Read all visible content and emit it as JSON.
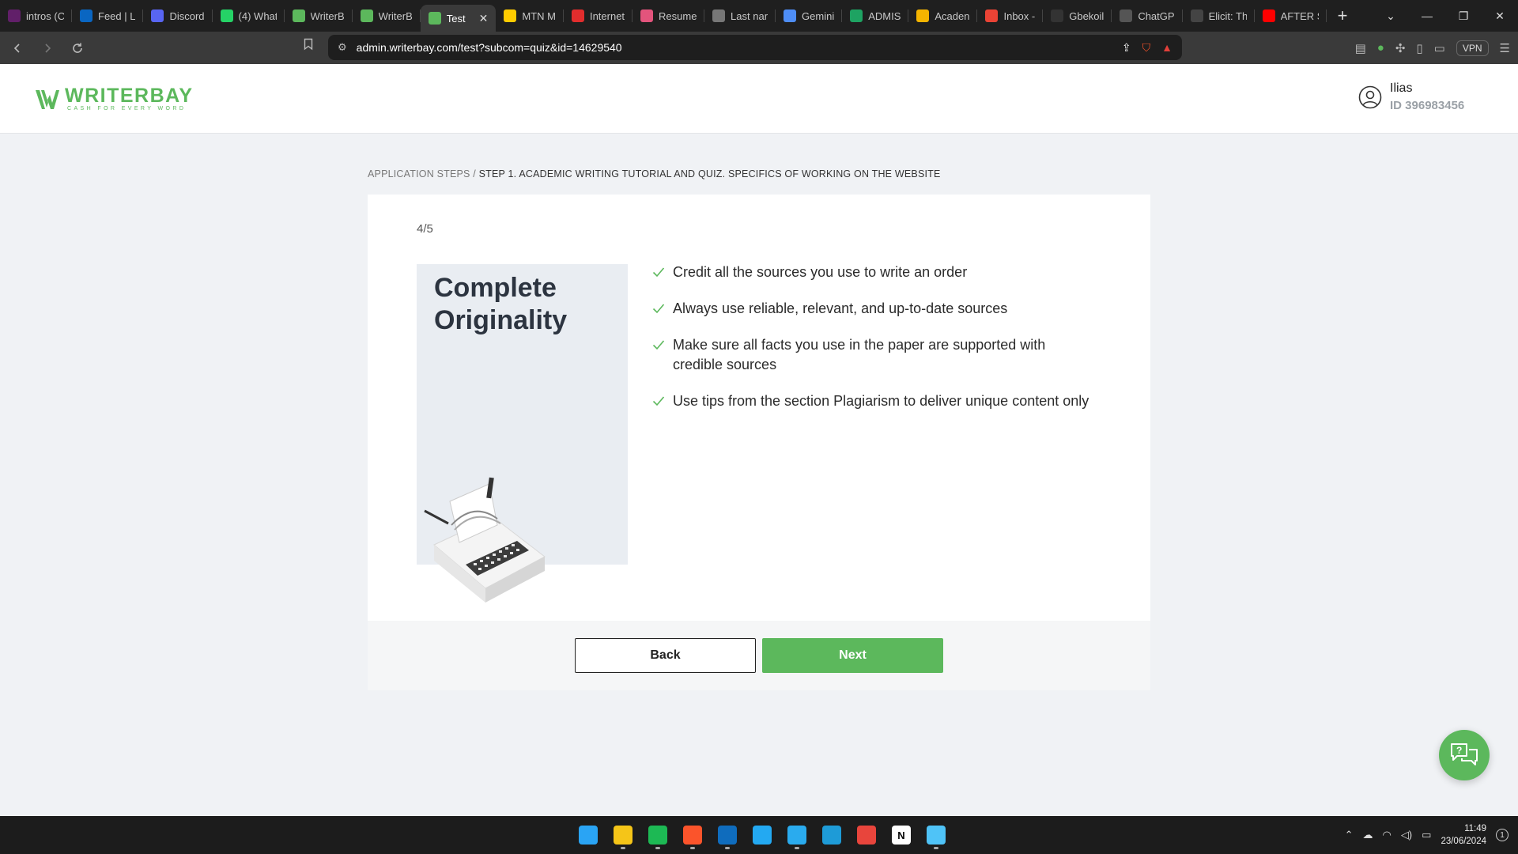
{
  "browser": {
    "tabs": [
      {
        "label": "intros (C",
        "icon": "slack-icon",
        "color": "#611f69"
      },
      {
        "label": "Feed | L",
        "icon": "linkedin-icon",
        "color": "#0a66c2"
      },
      {
        "label": "Discord",
        "icon": "discord-icon",
        "color": "#5865f2"
      },
      {
        "label": "(4) What",
        "icon": "whatsapp-icon",
        "color": "#25d366"
      },
      {
        "label": "WriterB",
        "icon": "writerbay-icon",
        "color": "#5cb85c"
      },
      {
        "label": "WriterB",
        "icon": "writerbay-icon",
        "color": "#5cb85c"
      },
      {
        "label": "Test",
        "icon": "writerbay-icon",
        "color": "#5cb85c",
        "active": true
      },
      {
        "label": "MTN M",
        "icon": "mtn-icon",
        "color": "#ffcc00"
      },
      {
        "label": "Internet",
        "icon": "internet-icon",
        "color": "#e22d2d"
      },
      {
        "label": "Resume",
        "icon": "resume-icon",
        "color": "#e3547c"
      },
      {
        "label": "Last nar",
        "icon": "gear-icon",
        "color": "#777777"
      },
      {
        "label": "Gemini",
        "icon": "gemini-icon",
        "color": "#4e8df5"
      },
      {
        "label": "ADMIS",
        "icon": "sheets-icon",
        "color": "#1ea362"
      },
      {
        "label": "Acaden",
        "icon": "drive-icon",
        "color": "#f4b400"
      },
      {
        "label": "Inbox -",
        "icon": "gmail-icon",
        "color": "#ea4335"
      },
      {
        "label": "Gbekoil",
        "icon": "github-icon",
        "color": "#333333"
      },
      {
        "label": "ChatGP",
        "icon": "chatgpt-icon",
        "color": "#555555"
      },
      {
        "label": "Elicit: Th",
        "icon": "elicit-icon",
        "color": "#444444"
      },
      {
        "label": "AFTER S",
        "icon": "youtube-icon",
        "color": "#ff0000"
      }
    ],
    "url": "admin.writerbay.com/test?subcom=quiz&id=14629540",
    "vpn_label": "VPN"
  },
  "site": {
    "logo_name": "WRITERBAY",
    "logo_tagline": "CASH FOR EVERY WORD",
    "user_name": "Ilias",
    "user_id": "ID 396983456"
  },
  "breadcrumb": {
    "root": "APPLICATION STEPS /",
    "current": "STEP 1. ACADEMIC WRITING TUTORIAL AND QUIZ. SPECIFICS OF WORKING ON THE WEBSITE"
  },
  "lesson": {
    "progress": "4/5",
    "title_line1": "Complete",
    "title_line2": "Originality",
    "tips": [
      "Credit all the sources you use to write an order",
      "Always use reliable, relevant, and up-to-date sources",
      "Make sure all facts you use in the paper are supported with credible sources",
      "Use tips from the section Plagiarism to deliver unique content only"
    ],
    "back_label": "Back",
    "next_label": "Next"
  },
  "taskbar": {
    "apps": [
      {
        "name": "windows-start-icon",
        "color": "#2aa4f4",
        "running": false
      },
      {
        "name": "file-explorer-icon",
        "color": "#f5c518",
        "running": true
      },
      {
        "name": "spotify-icon",
        "color": "#1db954",
        "running": true
      },
      {
        "name": "brave-icon",
        "color": "#fb542b",
        "running": true
      },
      {
        "name": "outlook-icon",
        "color": "#0f6cbd",
        "running": true
      },
      {
        "name": "vscode-icon",
        "color": "#23a9f2",
        "running": false
      },
      {
        "name": "telegram-icon",
        "color": "#2aabee",
        "running": true
      },
      {
        "name": "edge-icon",
        "color": "#1e9bd7",
        "running": false
      },
      {
        "name": "chrome-icon",
        "color": "#e8453c",
        "running": false
      },
      {
        "name": "notion-icon",
        "color": "#ffffff",
        "running": false
      },
      {
        "name": "notepad-icon",
        "color": "#4fc3f7",
        "running": true
      }
    ],
    "time": "11:49",
    "date": "23/06/2024",
    "notifications": "1"
  },
  "colors": {
    "brand_green": "#5cb85c",
    "page_bg": "#f0f2f5"
  }
}
